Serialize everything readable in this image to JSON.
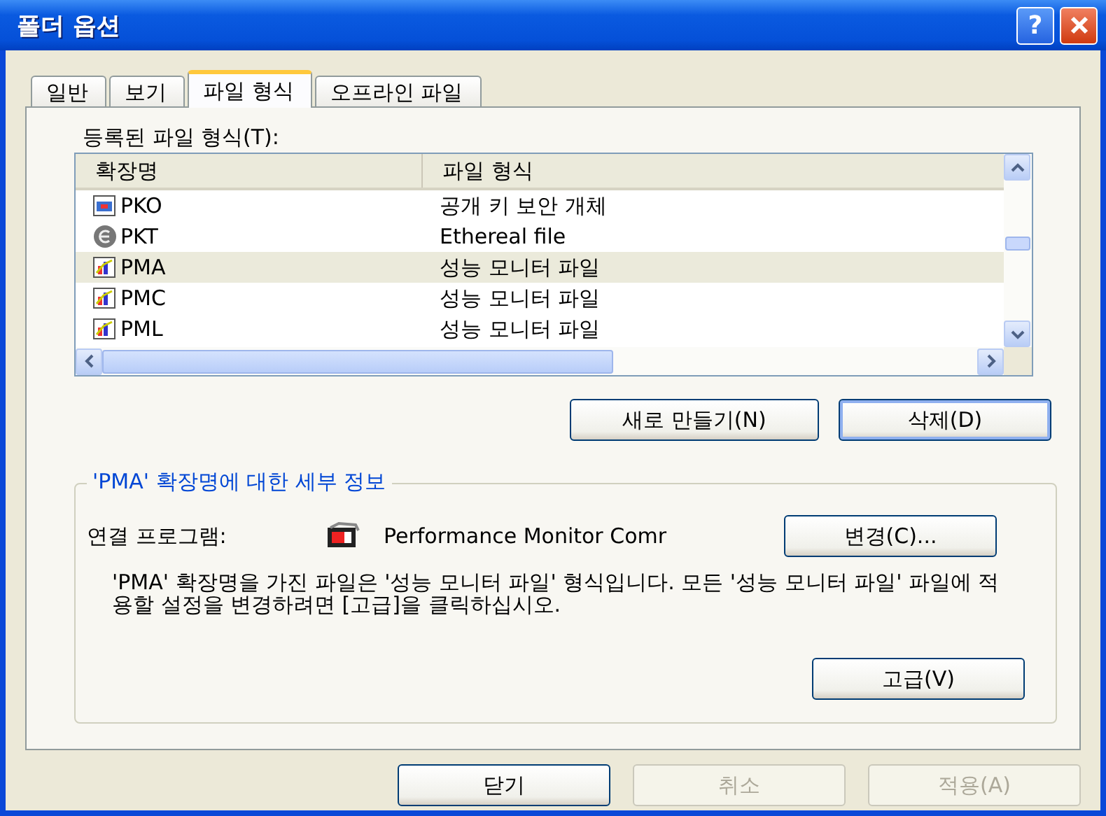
{
  "window": {
    "title": "폴더 옵션",
    "help_button": "?"
  },
  "tabs": [
    {
      "label": "일반",
      "selected": false
    },
    {
      "label": "보기",
      "selected": false
    },
    {
      "label": "파일 형식",
      "selected": true
    },
    {
      "label": "오프라인 파일",
      "selected": false
    }
  ],
  "list_label": "등록된 파일 형식(T):",
  "table": {
    "columns": [
      "확장명",
      "파일 형식"
    ],
    "rows": [
      {
        "kind": "object",
        "extension": "PKO",
        "type": "공개 키 보안 개체",
        "selected": false
      },
      {
        "kind": "ethereal",
        "extension": "PKT",
        "type": "Ethereal file",
        "selected": false
      },
      {
        "kind": "monitor",
        "extension": "PMA",
        "type": "성능 모니터 파일",
        "selected": true
      },
      {
        "kind": "monitor",
        "extension": "PMC",
        "type": "성능 모니터 파일",
        "selected": false
      },
      {
        "kind": "monitor",
        "extension": "PML",
        "type": "성능 모니터 파일",
        "selected": false
      }
    ]
  },
  "list_buttons": [
    {
      "label": "새로 만들기(N)",
      "default": false
    },
    {
      "label": "삭제(D)",
      "default": true
    }
  ],
  "details": {
    "title": "'PMA' 확장명에 대한 세부 정보",
    "opens_with_label": "연결 프로그램:",
    "program": "Performance Monitor Comr",
    "change_button": "변경(C)...",
    "description": "'PMA' 확장명을 가진 파일은 '성능 모니터 파일' 형식입니다. 모든 '성능 모니터 파일' 파일에 적용할 설정을 변경하려면 [고급]을 클릭하십시오.",
    "advanced_button": "고급(V)"
  },
  "buttons": [
    {
      "label": "닫기",
      "disabled": false
    },
    {
      "label": "취소",
      "disabled": true
    },
    {
      "label": "적용(A)",
      "disabled": true
    }
  ]
}
